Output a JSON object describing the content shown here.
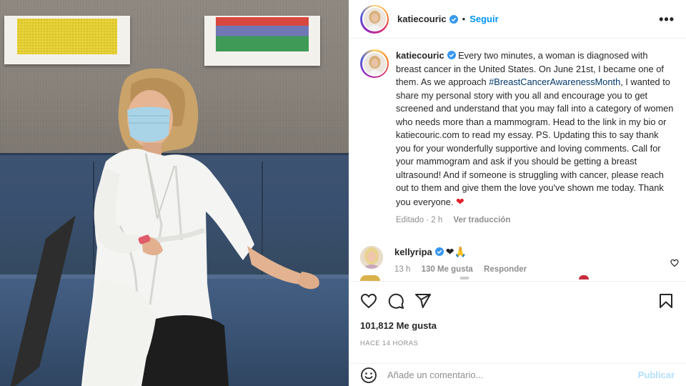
{
  "header": {
    "username": "katiecouric",
    "separator": "•",
    "follow_label": "Seguir",
    "more_label": "•••"
  },
  "caption": {
    "username": "katiecouric",
    "text_before": " Every two minutes, a woman is diagnosed with breast cancer in the United States. On June 21st, I became one of them. As we approach ",
    "hashtag": "#BreastCancerAwarenessMonth",
    "text_after": ", I wanted to share my personal story with you all and encourage you to get screened and understand that you may fall into a category of women who needs more than a mammogram. Head to the link in my bio or katiecouric.com to read my essay. PS. Updating this to say thank you for your wonderfully supportive and loving comments. Call for your mammogram and ask if you should be getting a breast ultrasound! And if someone is struggling with cancer, please reach out to them and give them the love you've shown me today. Thank you everyone. ",
    "emoji": "❤",
    "edited": "Editado",
    "time": "2 h",
    "translate": "Ver traducción"
  },
  "comments": [
    {
      "username": "kellyripa",
      "emojis": "❤🙏",
      "time": "13 h",
      "likes": "130 Me gusta",
      "reply": "Responder"
    }
  ],
  "actions": {
    "likes": "101,812 Me gusta",
    "time_ago": "HACE 14 HORAS"
  },
  "add_comment": {
    "placeholder": "Añade un comentario...",
    "publish": "Publicar"
  },
  "colors": {
    "accent": "#0095f6",
    "hashtag": "#00376b",
    "verified": "#3897f0",
    "heart": "#ed4956",
    "publish_disabled": "#b2dffc",
    "muted": "#8e8e8e"
  },
  "icons": [
    "verified-badge-icon",
    "more-options-icon",
    "heart-icon",
    "comment-icon",
    "share-icon",
    "save-icon",
    "emoji-icon",
    "comment-like-icon"
  ]
}
